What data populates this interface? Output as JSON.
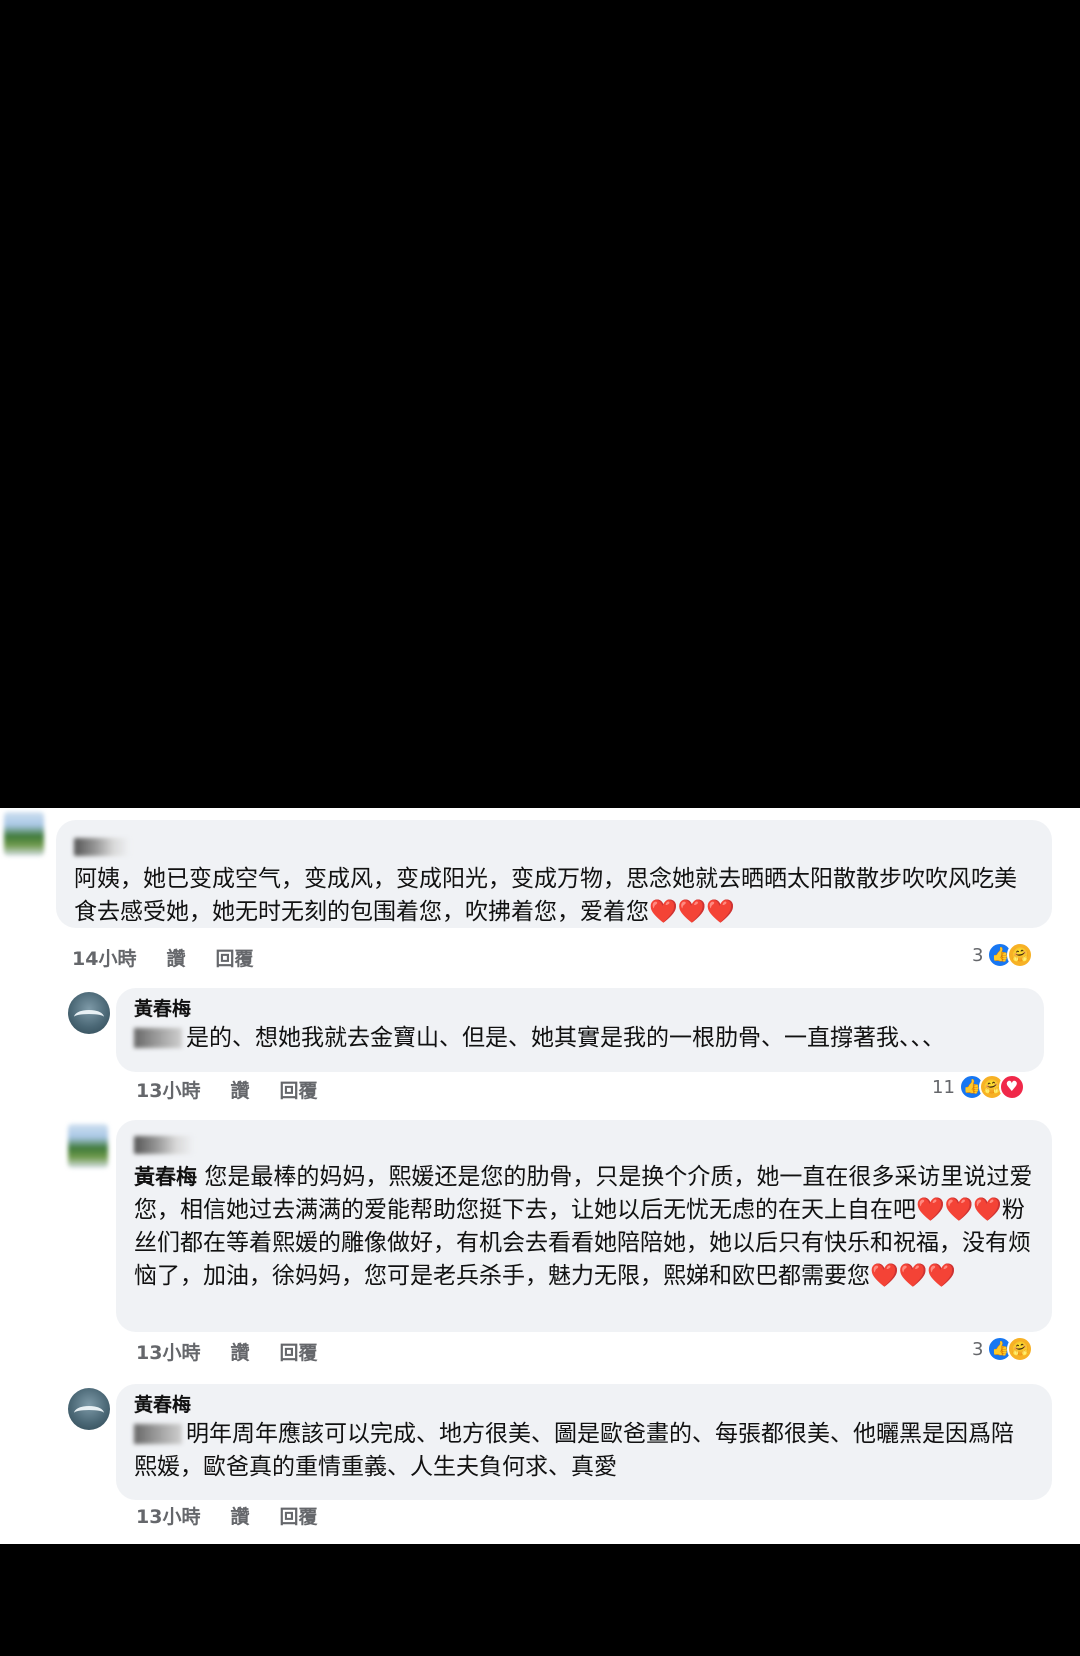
{
  "comments": [
    {
      "name_blurred": "",
      "text": "阿姨，她已变成空气，变成风，变成阳光，变成万物，思念她就去晒晒太阳散散步吹吹风吃美食去感受她，她无时无刻的包围着您，吹拂着您，爱着您❤️❤️❤️",
      "time": "14小時",
      "like": "讚",
      "reply": "回覆",
      "reaction_count": "3"
    },
    {
      "name": "黃春梅",
      "text": "是的、想她我就去金寶山、但是、她其實是我的一根肋骨、一直撐著我、、、",
      "time": "13小時",
      "like": "讚",
      "reply": "回覆",
      "reaction_count": "11"
    },
    {
      "name_blurred": "",
      "tag": "黃春梅",
      "text": "您是最棒的妈妈，熙媛还是您的肋骨，只是换个介质，她一直在很多采访里说过爱您，相信她过去满满的爱能帮助您挺下去，让她以后无忧无虑的在天上自在吧❤️❤️❤️粉丝们都在等着熙媛的雕像做好，有机会去看看她陪陪她，她以后只有快乐和祝福，没有烦恼了，加油，徐妈妈，您可是老兵杀手，魅力无限，熙娣和欧巴都需要您❤️❤️❤️",
      "time": "13小時",
      "like": "讚",
      "reply": "回覆",
      "reaction_count": "3"
    },
    {
      "name": "黃春梅",
      "text": "明年周年應該可以完成、地方很美、圖是歐爸畫的、每張都很美、他曬黑是因爲陪熙媛，歐爸真的重情重義、人生夫負何求、真愛",
      "time": "13小時",
      "like": "讚",
      "reply": "回覆"
    }
  ]
}
